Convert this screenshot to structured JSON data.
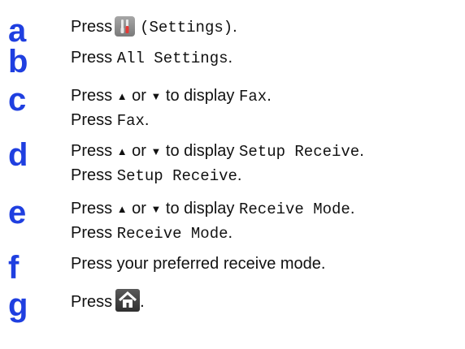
{
  "steps": [
    {
      "letter": "a",
      "lines": [
        {
          "pre": "Press",
          "mid": "(Settings)",
          "post": "."
        }
      ]
    },
    {
      "letter": "b",
      "lines": [
        {
          "pre": "Press",
          "code": "All Settings",
          "post": "."
        }
      ]
    },
    {
      "letter": "c",
      "lines": [
        {
          "pre": "Press",
          "up": "▲",
          "or": "or",
          "down": "▼",
          "to": "to display",
          "code": "Fax",
          "post": "."
        },
        {
          "pre": "Press",
          "code": "Fax",
          "post": "."
        }
      ]
    },
    {
      "letter": "d",
      "lines": [
        {
          "pre": "Press",
          "up": "▲",
          "or": "or",
          "down": "▼",
          "to": "to display",
          "code": "Setup Receive",
          "post": "."
        },
        {
          "pre": "Press",
          "code": "Setup Receive",
          "post": "."
        }
      ]
    },
    {
      "letter": "e",
      "lines": [
        {
          "pre": "Press",
          "up": "▲",
          "or": "or",
          "down": "▼",
          "to": "to display",
          "code": "Receive Mode",
          "post": "."
        },
        {
          "pre": "Press",
          "code": "Receive Mode",
          "post": "."
        }
      ]
    },
    {
      "letter": "f",
      "lines": [
        {
          "text": "Press your preferred receive mode."
        }
      ]
    },
    {
      "letter": "g",
      "lines": [
        {
          "pre": "Press",
          "post": "."
        }
      ]
    }
  ],
  "icons": {
    "settings": "settings-icon",
    "home": "home-icon"
  },
  "colors": {
    "step_letter": "#1f3fe0",
    "text": "#111111"
  }
}
